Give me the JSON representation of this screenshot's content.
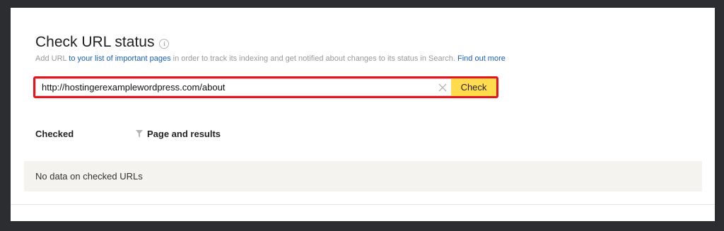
{
  "page": {
    "title": "Check URL status",
    "subtitle": {
      "prefix": "Add URL ",
      "link_important_pages": "to your list of important pages",
      "middle": " in order to track its indexing and get notified about changes to its status in Search. ",
      "link_find_out_more": "Find out more"
    }
  },
  "form": {
    "url_value": "http://hostingerexamplewordpress.com/about",
    "check_label": "Check"
  },
  "table": {
    "columns": [
      "Checked",
      "Page and results"
    ],
    "empty_text": "No data on checked URLs"
  },
  "colors": {
    "check_button": "#ffdb4d",
    "highlight_border": "#e8141b",
    "link": "#1a5fb4"
  }
}
